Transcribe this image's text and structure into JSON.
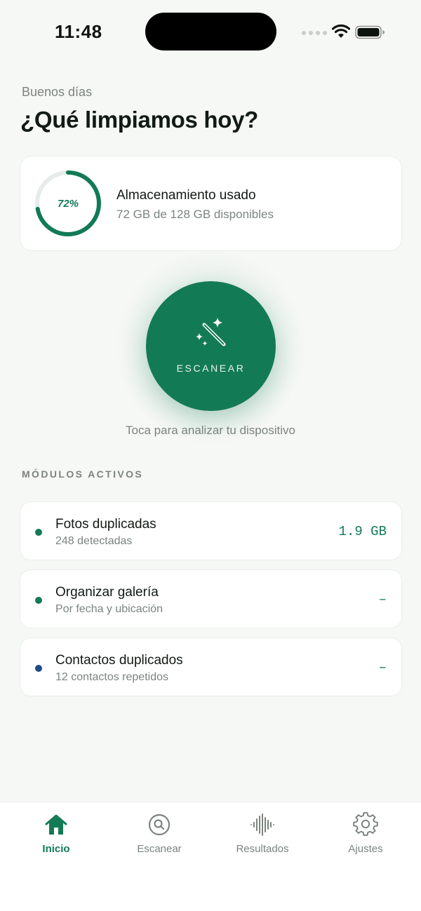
{
  "status_bar": {
    "time": "11:48"
  },
  "header": {
    "greeting": "Buenos días",
    "title": "¿Qué limpiamos hoy?"
  },
  "storage": {
    "percent_label": "72%",
    "percent_used": 0.72,
    "title": "Almacenamiento usado",
    "subtitle": "72 GB de 128 GB disponibles"
  },
  "scan": {
    "button_label": "ESCANEAR",
    "hint": "Toca para analizar tu dispositivo"
  },
  "modules": {
    "section_title": "MÓDULOS ACTIVOS",
    "items": [
      {
        "title": "Fotos duplicadas",
        "subtitle": "248 detectadas",
        "value": "1.9 GB",
        "dot_color": "#137A56"
      },
      {
        "title": "Organizar galería",
        "subtitle": "Por fecha y ubicación",
        "value": "–",
        "dot_color": "#137A56"
      },
      {
        "title": "Contactos duplicados",
        "subtitle": "12 contactos repetidos",
        "value": "–",
        "dot_color": "#1F4A8C"
      }
    ]
  },
  "tabs": [
    {
      "label": "Inicio",
      "icon": "home-icon",
      "active": true
    },
    {
      "label": "Escanear",
      "icon": "search-icon",
      "active": false
    },
    {
      "label": "Resultados",
      "icon": "waveform-icon",
      "active": false
    },
    {
      "label": "Ajustes",
      "icon": "gear-icon",
      "active": false
    }
  ],
  "colors": {
    "accent": "#137A56",
    "background": "#F6F8F6",
    "muted_text": "#7B847F",
    "contacts_dot": "#1F4A8C"
  }
}
